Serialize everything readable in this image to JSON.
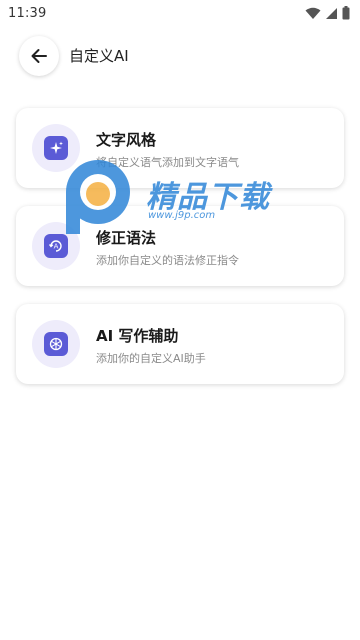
{
  "status_bar": {
    "time": "11:39"
  },
  "header": {
    "title": "自定义AI"
  },
  "cards": [
    {
      "title": "文字风格",
      "description": "将自定义语气添加到文字语气",
      "icon": "sparkle-icon"
    },
    {
      "title": "修正语法",
      "description": "添加你自定义的语法修正指令",
      "icon": "grammar-icon"
    },
    {
      "title": "AI 写作辅助",
      "description": "添加你的自定义AI助手",
      "icon": "ai-assistant-icon"
    }
  ],
  "watermark": {
    "text": "精品下载",
    "url": "www.j9p.com"
  },
  "colors": {
    "accent": "#5b5bd6",
    "icon_bg": "#eeecfb",
    "watermark": "#2f86d8"
  }
}
